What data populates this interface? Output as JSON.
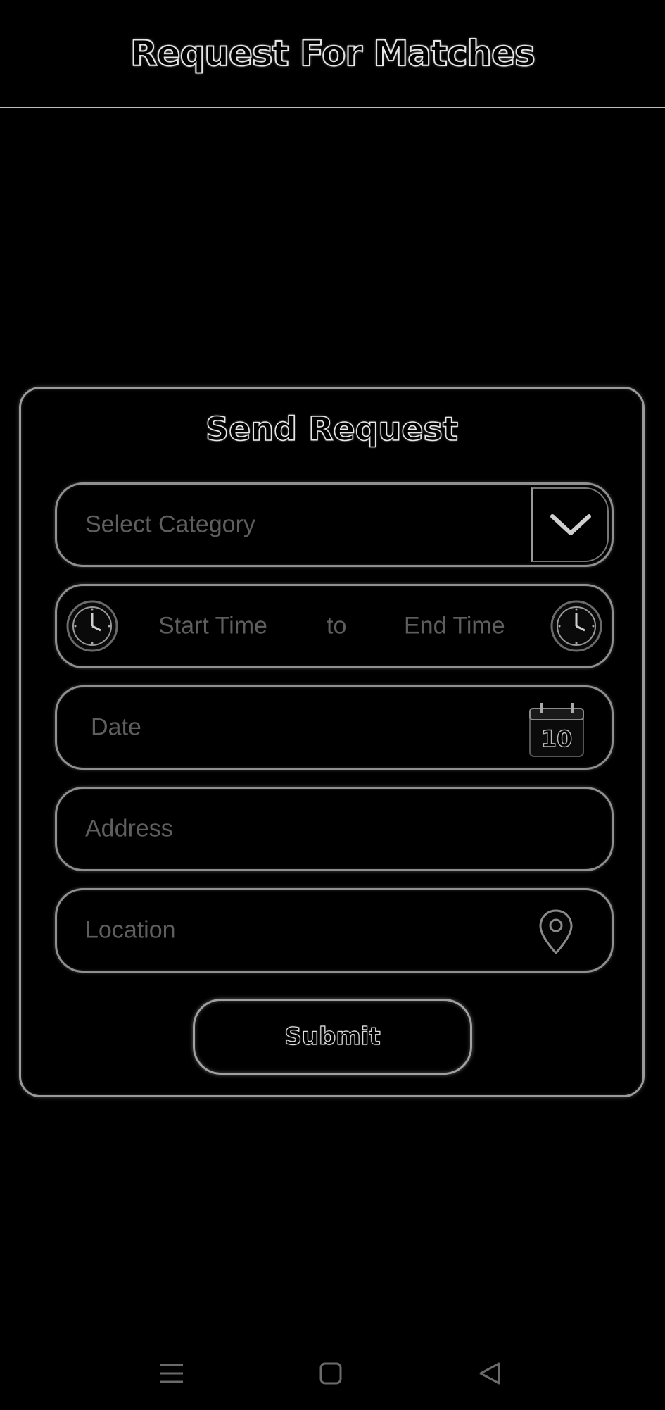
{
  "header": {
    "title": "Request For Matches"
  },
  "card": {
    "title": "Send Request",
    "category": {
      "placeholder": "Select Category"
    },
    "time": {
      "start_placeholder": "Start Time",
      "separator": "to",
      "end_placeholder": "End Time"
    },
    "date": {
      "placeholder": "Date",
      "calendar_day": "10"
    },
    "address": {
      "placeholder": "Address"
    },
    "location": {
      "placeholder": "Location"
    },
    "submit_label": "Submit"
  },
  "icons": {
    "dropdown": "chevron-down-icon",
    "start_clock": "clock-icon",
    "end_clock": "clock-icon",
    "calendar": "calendar-icon",
    "location": "map-pin-icon",
    "nav_menu": "menu-icon",
    "nav_home": "home-square-icon",
    "nav_back": "back-triangle-icon"
  },
  "colors": {
    "background": "#000000",
    "placeholder": "#5e5e5e",
    "outline": "#9a9a9a"
  }
}
